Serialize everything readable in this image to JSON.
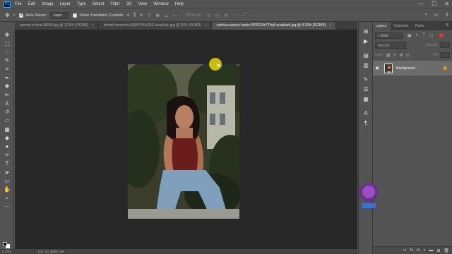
{
  "app": {
    "logo": "Ps"
  },
  "menu": [
    "File",
    "Edit",
    "Image",
    "Layer",
    "Type",
    "Select",
    "Filter",
    "3D",
    "View",
    "Window",
    "Help"
  ],
  "window_controls": {
    "minimize": "—",
    "maximize": "☐",
    "close": "✕"
  },
  "options": {
    "auto_select_label": "Auto-Select:",
    "auto_select_target": "Layer",
    "show_transform_label": "Show Transform Controls",
    "mode_3d_label": "3D Mode:"
  },
  "tabs": [
    {
      "label": "woman-s-face-38299.jpg @ 12.5% (RGB/8)",
      "close": "×",
      "active": false
    },
    {
      "label": "kimsef-usmanici-Ek5WVi2bSDE-unsplash.jpg @ 25% (RGB/8)",
      "close": "×",
      "active": false
    },
    {
      "label": "joshua-rawson-harris-6PRGVhY2Yq4-unsplash.jpg @ 8.33% (RGB/8)",
      "close": "×",
      "active": true
    }
  ],
  "status": {
    "zoom": "8.33%",
    "doc": "Doc: 61.3M/61.3M"
  },
  "panel": {
    "tabs": [
      "Layers",
      "Channels",
      "Paths"
    ],
    "kind_placeholder": "Kind",
    "blend_mode": "Normal",
    "opacity_label": "Opacity:",
    "lock_label": "Lock:",
    "fill_label": "Fill:",
    "layers": [
      {
        "name": "Background",
        "locked": true,
        "visible": true
      }
    ]
  },
  "icons": {
    "tools": [
      "move-icon",
      "marquee-icon",
      "lasso-icon",
      "quick-select-icon",
      "crop-icon",
      "eyedropper-icon",
      "healing-brush-icon",
      "brush-icon",
      "clone-stamp-icon",
      "history-brush-icon",
      "eraser-icon",
      "gradient-icon",
      "blur-icon",
      "dodge-icon",
      "pen-icon",
      "type-icon",
      "path-select-icon",
      "rectangle-icon",
      "hand-icon",
      "zoom-icon",
      "more-tools-icon"
    ],
    "right_strip": [
      "history-icon",
      "play-icon",
      "adjust-icon",
      "layer-comps-icon",
      "brush-settings-icon",
      "clone-source-icon",
      "character-icon",
      "paragraph-icon",
      "glyphs-icon"
    ]
  },
  "colors": {
    "accent": "#31a8ff",
    "canvas_bg": "#282828",
    "ui_bg": "#535353"
  }
}
